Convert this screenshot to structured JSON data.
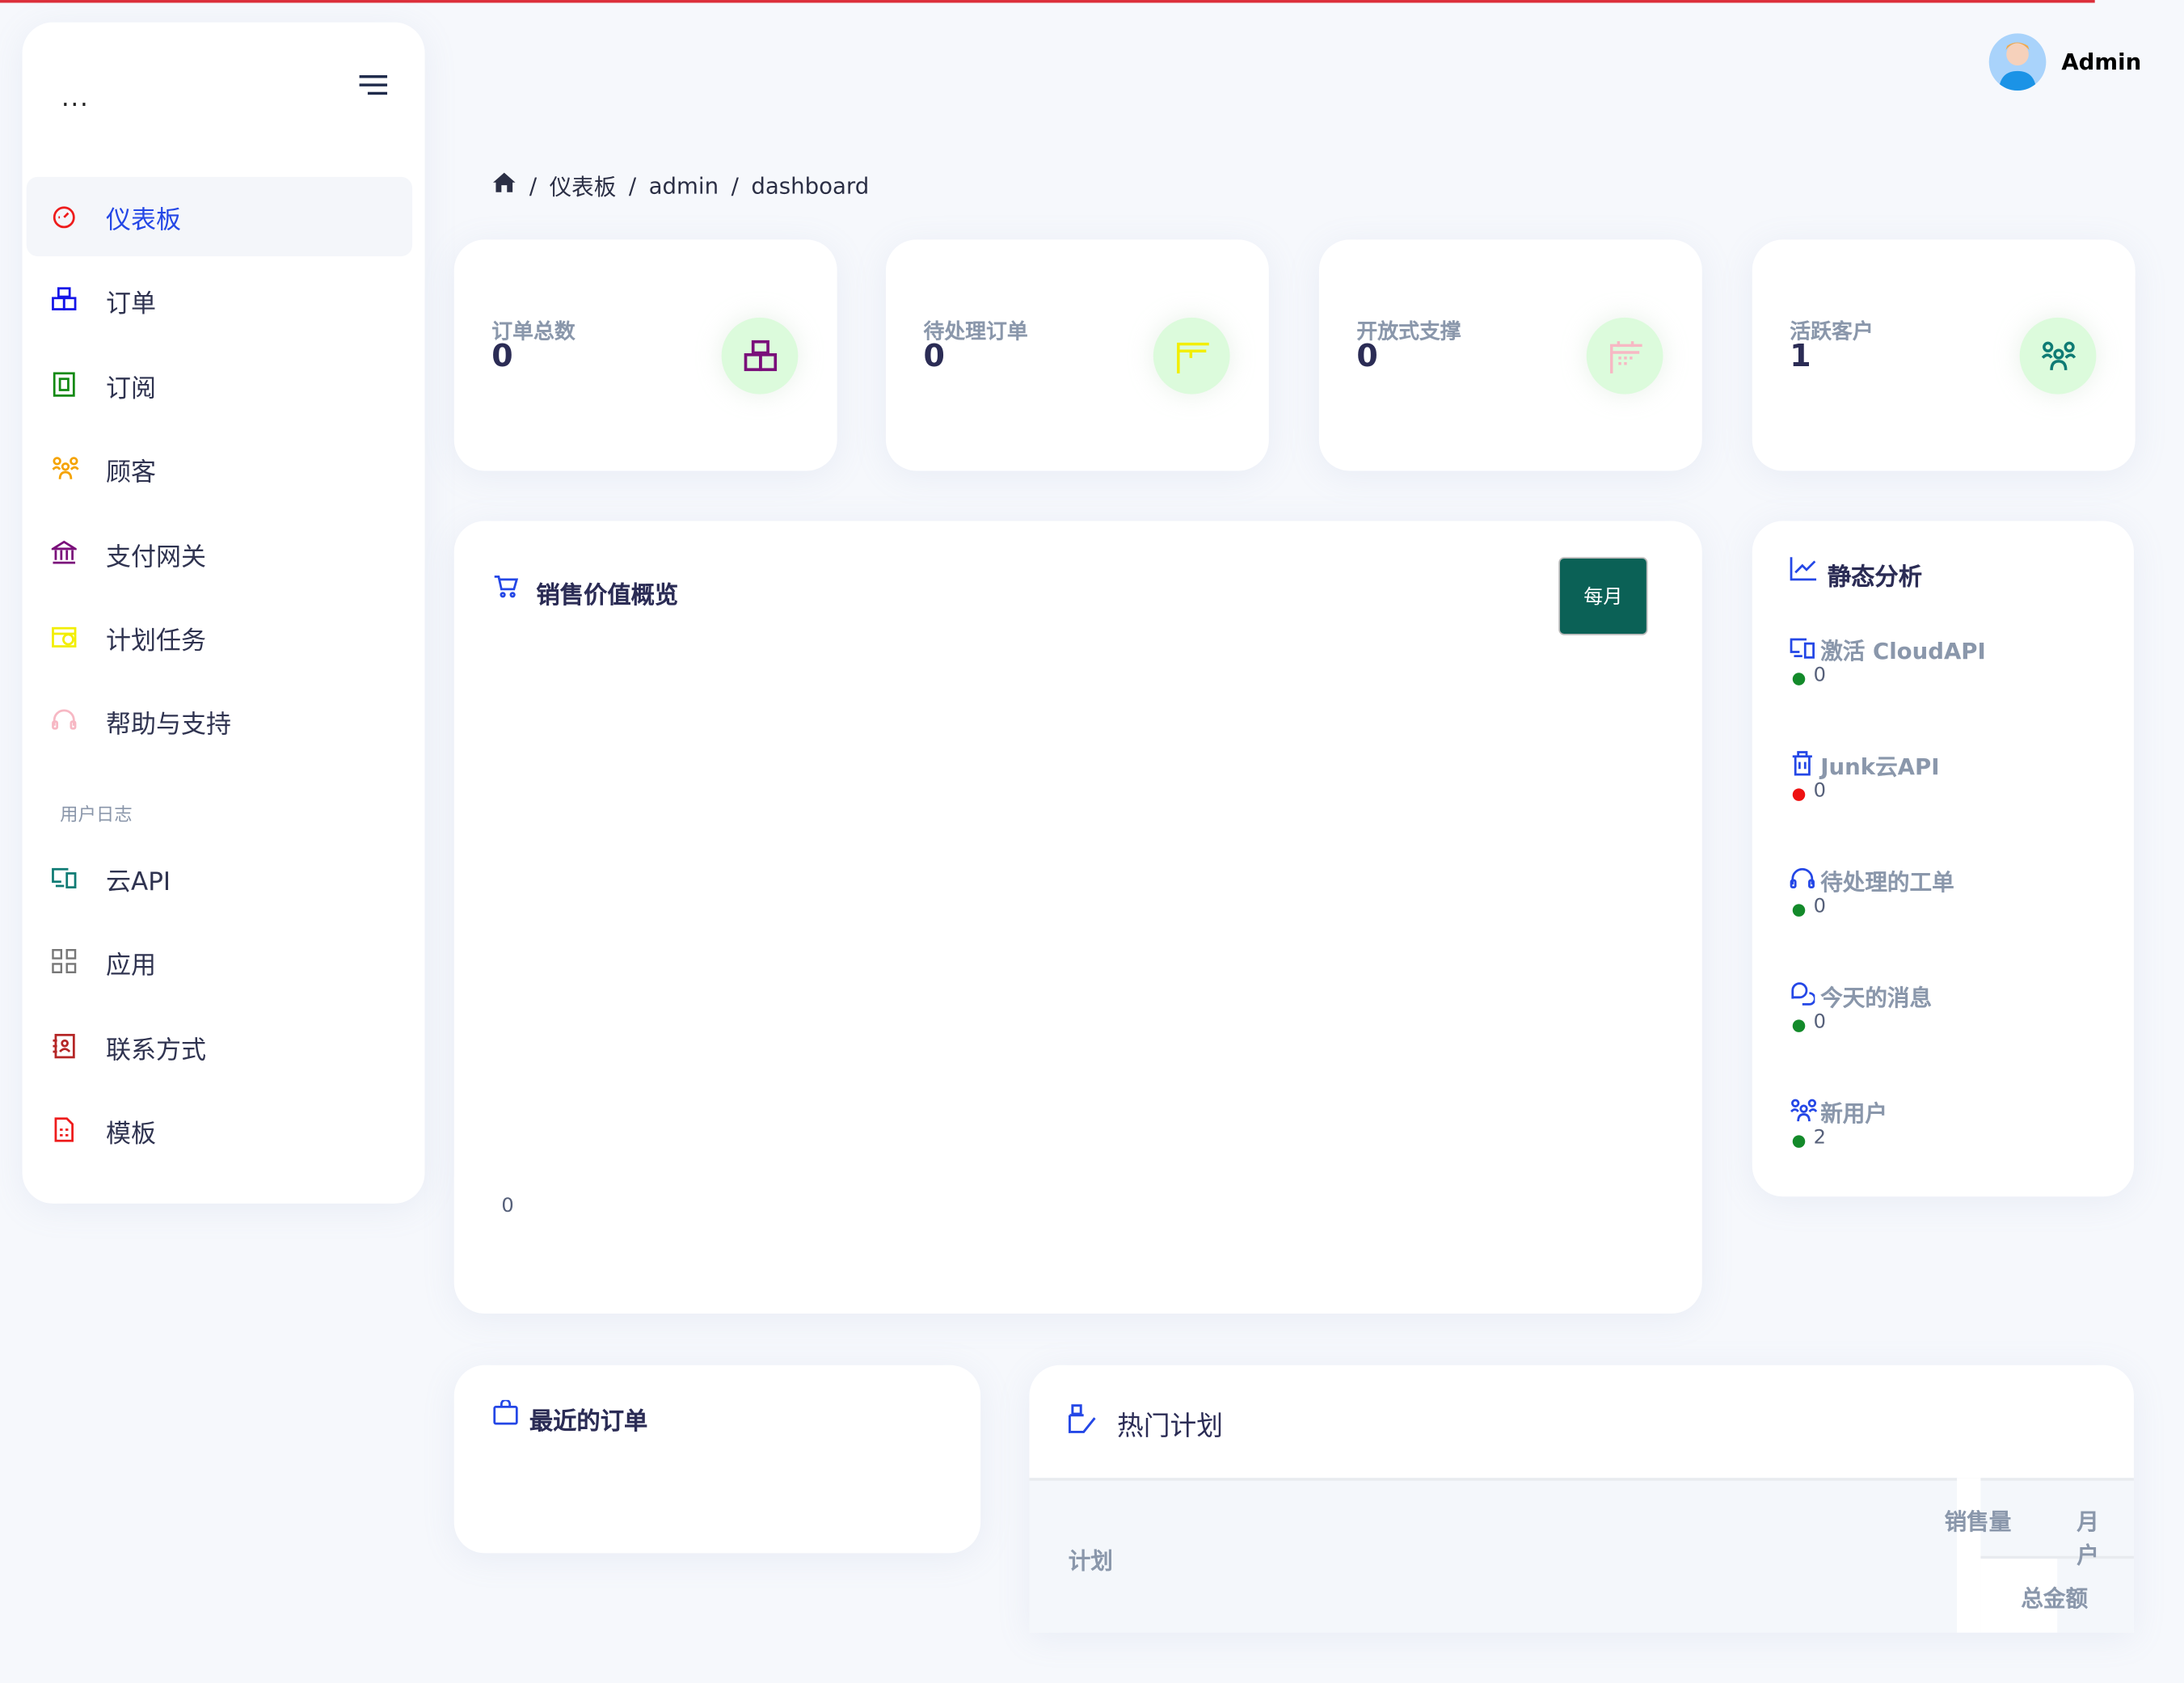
{
  "header": {
    "user_name": "Admin",
    "avatar": "avatar-illustration"
  },
  "sidebar": {
    "menu": "...",
    "items": [
      {
        "label": "仪表板",
        "icon": "speedometer-icon",
        "color": "#ee1c1c",
        "active": true
      },
      {
        "label": "订单",
        "icon": "boxes-icon",
        "color": "#1515e8"
      },
      {
        "label": "订阅",
        "icon": "subscription-icon",
        "color": "#138a13"
      },
      {
        "label": "顾客",
        "icon": "users-icon",
        "color": "#f5a300"
      },
      {
        "label": "支付网关",
        "icon": "bank-icon",
        "color": "#7a0f7a"
      },
      {
        "label": "计划任务",
        "icon": "calendar-clock-icon",
        "color": "#f2ee00"
      },
      {
        "label": "帮助与支持",
        "icon": "headset-icon",
        "color": "#f7b8c4"
      }
    ],
    "section_label": "用户日志",
    "items2": [
      {
        "label": "云API",
        "icon": "devices-icon",
        "color": "#0f7b74"
      },
      {
        "label": "应用",
        "icon": "grid-icon",
        "color": "#777"
      },
      {
        "label": "联系方式",
        "icon": "contact-book-icon",
        "color": "#b52626"
      },
      {
        "label": "模板",
        "icon": "template-icon",
        "color": "#ee1c1c"
      }
    ]
  },
  "breadcrumb": [
    "仪表板",
    "admin",
    "dashboard"
  ],
  "stats": [
    {
      "label": "订单总数",
      "value": "0",
      "icon": "boxes-icon",
      "color": "#7a0f7a"
    },
    {
      "label": "待处理订单",
      "value": "0",
      "icon": "package-icon",
      "color": "#f2ee00"
    },
    {
      "label": "开放式支撑",
      "value": "0",
      "icon": "calendar-icon",
      "color": "#f7b8c4"
    },
    {
      "label": "活跃客户",
      "value": "1",
      "icon": "users-icon",
      "color": "#0f7b74"
    }
  ],
  "sales": {
    "title": "销售价值概览",
    "button": "每月",
    "y_tick": "0"
  },
  "chart_data": {
    "type": "line",
    "title": "销售价值概览",
    "categories": [],
    "values": [],
    "yticks": [
      "0"
    ]
  },
  "analysis": {
    "title": "静态分析",
    "items": [
      {
        "label": "激活 CloudAPI",
        "value": "0",
        "status": "#138a2a",
        "icon": "devices-icon"
      },
      {
        "label": "Junk云API",
        "value": "0",
        "status": "#ee1111",
        "icon": "trash-icon"
      },
      {
        "label": "待处理的工单",
        "value": "0",
        "status": "#138a2a",
        "icon": "headset-icon"
      },
      {
        "label": "今天的消息",
        "value": "0",
        "status": "#138a2a",
        "icon": "chat-icon"
      },
      {
        "label": "新用户",
        "value": "2",
        "status": "#138a2a",
        "icon": "users-icon"
      }
    ]
  },
  "recent_orders": {
    "title": "最近的订单"
  },
  "hot_plans": {
    "title": "热门计划",
    "columns": {
      "plan": "计划",
      "sales": "销售量",
      "month_users": "月户",
      "total": "总金额"
    }
  }
}
